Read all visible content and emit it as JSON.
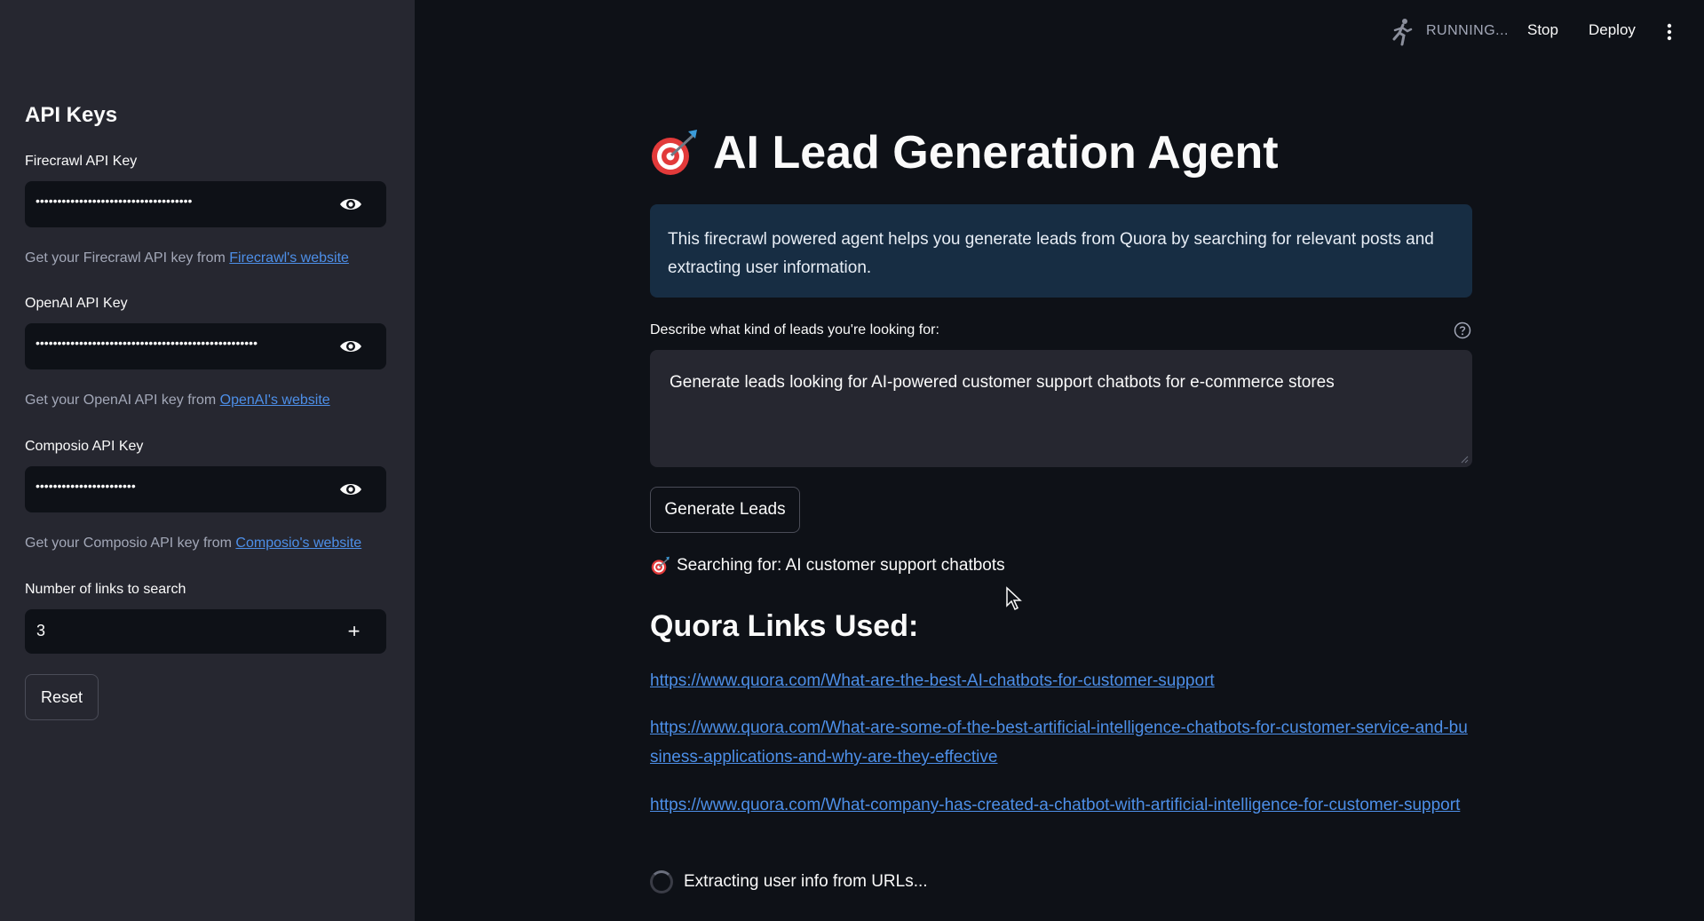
{
  "sidebar": {
    "title": "API Keys",
    "firecrawl": {
      "label": "Firecrawl API Key",
      "masked_value": "••••••••••••••••••••••••••••••••••••",
      "hint_prefix": "Get your Firecrawl API key from ",
      "hint_link": "Firecrawl's website"
    },
    "openai": {
      "label": "OpenAI API Key",
      "masked_value": "•••••••••••••••••••••••••••••••••••••••••••••••••••",
      "hint_prefix": "Get your OpenAI API key from ",
      "hint_link": "OpenAI's website"
    },
    "composio": {
      "label": "Composio API Key",
      "masked_value": "•••••••••••••••••••••••",
      "hint_prefix": "Get your Composio API key from ",
      "hint_link": "Composio's website"
    },
    "num_links": {
      "label": "Number of links to search",
      "value": "3",
      "minus": "−",
      "plus": "+"
    },
    "reset_label": "Reset"
  },
  "topbar": {
    "status": "RUNNING...",
    "stop_label": "Stop",
    "deploy_label": "Deploy"
  },
  "main": {
    "title": "AI Lead Generation Agent",
    "info": "This firecrawl powered agent helps you generate leads from Quora by searching for relevant posts and extracting user information.",
    "describe_label": "Describe what kind of leads you're looking for:",
    "query_value": "Generate leads looking for AI-powered customer support chatbots for e-commerce stores",
    "generate_label": "Generate Leads",
    "searching_text": "Searching for: AI customer support chatbots",
    "links_title": "Quora Links Used:",
    "links": [
      "https://www.quora.com/What-are-the-best-AI-chatbots-for-customer-support",
      "https://www.quora.com/What-are-some-of-the-best-artificial-intelligence-chatbots-for-customer-service-and-business-applications-and-why-are-they-effective",
      "https://www.quora.com/What-company-has-created-a-chatbot-with-artificial-intelligence-for-customer-support"
    ],
    "extract_status": "Extracting user info from URLs..."
  },
  "colors": {
    "background": "#0e1117",
    "sidebar": "#262730",
    "info_box": "#172d43",
    "link": "#4d8fe8"
  },
  "icons": [
    "eye-icon",
    "help-icon",
    "target-emoji-icon",
    "running-man-icon",
    "kebab-menu-icon",
    "spinner-icon",
    "mouse-cursor-icon"
  ]
}
